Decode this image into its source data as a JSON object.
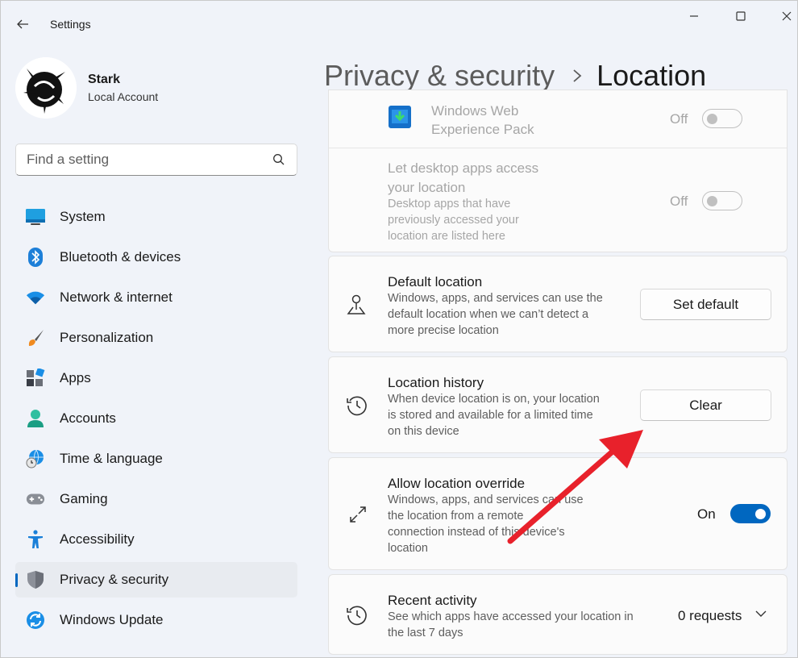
{
  "window": {
    "title": "Settings"
  },
  "profile": {
    "name": "Stark",
    "account_type": "Local Account"
  },
  "search": {
    "placeholder": "Find a setting"
  },
  "nav": {
    "items": [
      {
        "label": "System"
      },
      {
        "label": "Bluetooth & devices"
      },
      {
        "label": "Network & internet"
      },
      {
        "label": "Personalization"
      },
      {
        "label": "Apps"
      },
      {
        "label": "Accounts"
      },
      {
        "label": "Time & language"
      },
      {
        "label": "Gaming"
      },
      {
        "label": "Accessibility"
      },
      {
        "label": "Privacy & security",
        "active": true
      },
      {
        "label": "Windows Update"
      }
    ]
  },
  "breadcrumb": {
    "parent": "Privacy & security",
    "current": "Location"
  },
  "settings": {
    "web_experience": {
      "title_line1": "Windows Web",
      "title_line2": "Experience Pack",
      "state": "Off"
    },
    "desktop_apps": {
      "title_line1": "Let desktop apps access",
      "title_line2": "your location",
      "desc_line1": "Desktop apps that have",
      "desc_line2": "previously accessed your",
      "desc_line3": "location are listed here",
      "state": "Off"
    },
    "default_location": {
      "title": "Default location",
      "desc_line1": "Windows, apps, and services can use the",
      "desc_line2": "default location when we can’t detect a",
      "desc_line3": "more precise location",
      "button": "Set default"
    },
    "location_history": {
      "title": "Location history",
      "desc_line1": "When device location is on, your location",
      "desc_line2": "is stored and available for a limited time",
      "desc_line3": "on this device",
      "button": "Clear"
    },
    "location_override": {
      "title": "Allow location override",
      "desc_line1": "Windows, apps, and services can use",
      "desc_line2": "the location from a remote",
      "desc_line3": "connection instead of this device's",
      "desc_line4": "location",
      "state": "On"
    },
    "recent_activity": {
      "title": "Recent activity",
      "desc_line1": "See which apps have accessed your location in",
      "desc_line2": "the last 7 days",
      "count": "0 requests"
    }
  },
  "colors": {
    "accent": "#0067c0",
    "annotation_arrow": "#e8212b"
  }
}
